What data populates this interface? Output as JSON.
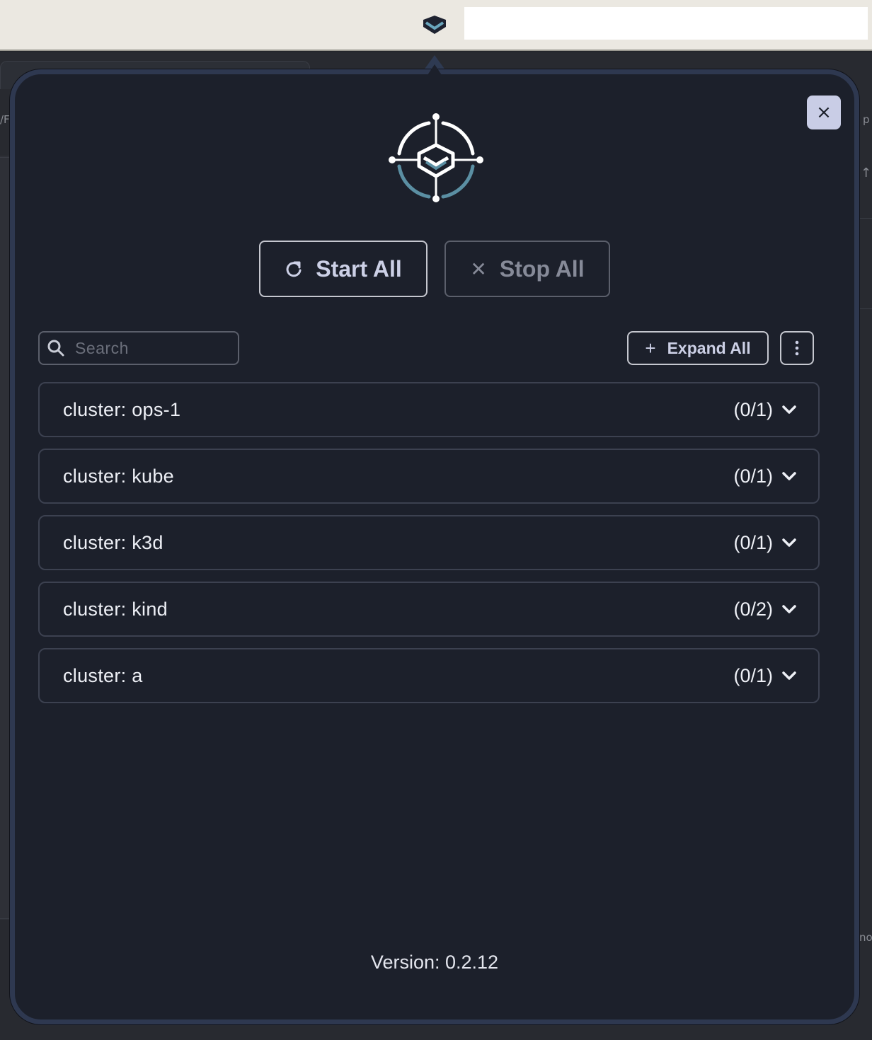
{
  "menubar": {
    "tray_icon": "chevron-shield-icon"
  },
  "background": {
    "left_fragment": "/F",
    "right_fragment_top": "p",
    "right_fragment_bottom": "no",
    "right_arrow": "↑"
  },
  "popover": {
    "close_icon": "×",
    "logo": "kube-forward-logo",
    "actions": {
      "start_all_label": "Start All",
      "stop_all_label": "Stop All",
      "stop_icon": "✕"
    },
    "search": {
      "placeholder": "Search",
      "value": ""
    },
    "expand_all_label": "Expand All",
    "expand_icon": "+",
    "clusters": [
      {
        "label": "cluster: ops-1",
        "count": "(0/1)"
      },
      {
        "label": "cluster: kube",
        "count": "(0/1)"
      },
      {
        "label": "cluster: k3d",
        "count": "(0/1)"
      },
      {
        "label": "cluster: kind",
        "count": "(0/2)"
      },
      {
        "label": "cluster: a",
        "count": "(0/1)"
      }
    ],
    "version": "Version: 0.2.12"
  },
  "colors": {
    "panel_bg": "#1c202b",
    "panel_border": "#2e3850",
    "accent": "#c9cde6",
    "logo_teal": "#5b8fa3"
  }
}
